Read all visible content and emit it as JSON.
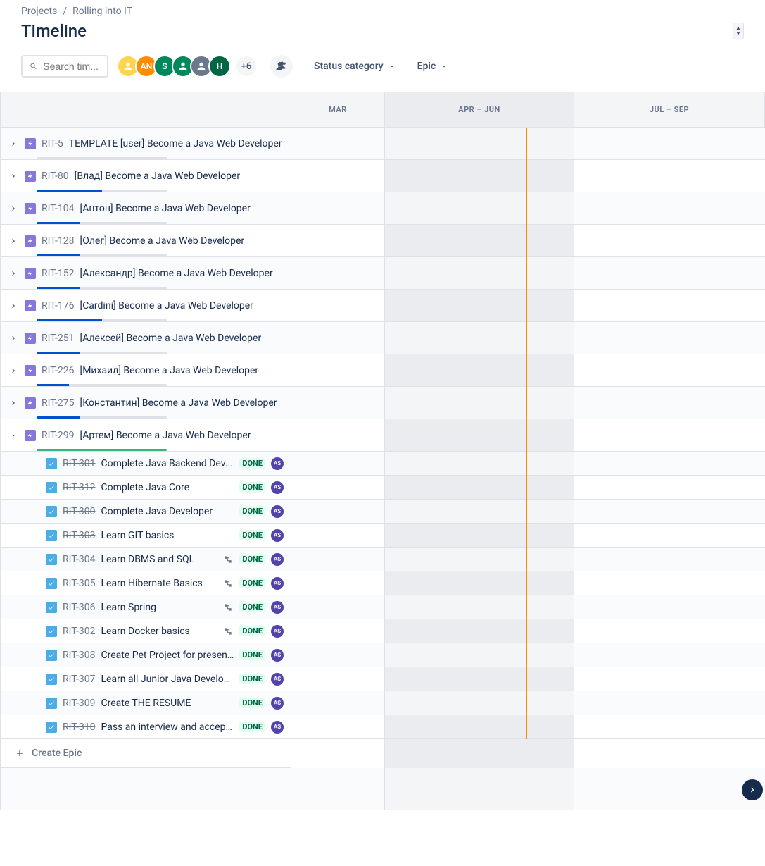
{
  "breadcrumb": {
    "projects": "Projects",
    "project_name": "Rolling into IT"
  },
  "page_title": "Timeline",
  "search": {
    "placeholder": "Search tim..."
  },
  "avatars": [
    {
      "label": "",
      "color": "yellow"
    },
    {
      "label": "AN",
      "color": "orange"
    },
    {
      "label": "S",
      "color": "green"
    },
    {
      "label": "",
      "color": "teal"
    },
    {
      "label": "",
      "color": "grey"
    },
    {
      "label": "H",
      "color": "darkgreen"
    }
  ],
  "avatars_more": "+6",
  "filters": {
    "status": "Status category",
    "epic": "Epic"
  },
  "columns": {
    "mar": "MAR",
    "apr_jun": "APR – JUN",
    "jul_sep": "JUL – SEP"
  },
  "epics": [
    {
      "key": "RIT-5",
      "summary": "TEMPLATE [user] Become a Java Web Developer",
      "expanded": false,
      "progress_blue": 0,
      "progress_green": 0
    },
    {
      "key": "RIT-80",
      "summary": "[Влад] Become a Java Web Developer",
      "expanded": false,
      "progress_blue": 50,
      "progress_green": 0
    },
    {
      "key": "RIT-104",
      "summary": "[Антон] Become a Java Web Developer",
      "expanded": false,
      "progress_blue": 33,
      "progress_green": 0
    },
    {
      "key": "RIT-128",
      "summary": "[Олег] Become a Java Web Developer",
      "expanded": false,
      "progress_blue": 33,
      "progress_green": 0
    },
    {
      "key": "RIT-152",
      "summary": "[Александр] Become a Java Web Developer",
      "expanded": false,
      "progress_blue": 33,
      "progress_green": 0
    },
    {
      "key": "RIT-176",
      "summary": "[Cardini] Become a Java Web Developer",
      "expanded": false,
      "progress_blue": 50,
      "progress_green": 0
    },
    {
      "key": "RIT-251",
      "summary": "[Алексей] Become a Java Web Developer",
      "expanded": false,
      "progress_blue": 33,
      "progress_green": 0
    },
    {
      "key": "RIT-226",
      "summary": "[Михаил] Become a Java Web Developer",
      "expanded": false,
      "progress_blue": 25,
      "progress_green": 0
    },
    {
      "key": "RIT-275",
      "summary": "[Константин] Become a Java Web Developer",
      "expanded": false,
      "progress_blue": 33,
      "progress_green": 0
    },
    {
      "key": "RIT-299",
      "summary": "[Артем] Become a Java Web Developer",
      "expanded": true,
      "progress_blue": 0,
      "progress_green": 100
    }
  ],
  "subtasks": [
    {
      "key": "RIT-301",
      "summary": "Complete Java Backend Dev...",
      "status": "DONE",
      "assignee": "AS",
      "dep": false
    },
    {
      "key": "RIT-312",
      "summary": "Complete Java Core",
      "status": "DONE",
      "assignee": "AS",
      "dep": false
    },
    {
      "key": "RIT-300",
      "summary": "Complete Java Developer",
      "status": "DONE",
      "assignee": "AS",
      "dep": false
    },
    {
      "key": "RIT-303",
      "summary": "Learn GIT basics",
      "status": "DONE",
      "assignee": "AS",
      "dep": false
    },
    {
      "key": "RIT-304",
      "summary": "Learn DBMS and SQL",
      "status": "DONE",
      "assignee": "AS",
      "dep": true
    },
    {
      "key": "RIT-305",
      "summary": "Learn Hibernate Basics",
      "status": "DONE",
      "assignee": "AS",
      "dep": true
    },
    {
      "key": "RIT-306",
      "summary": "Learn Spring",
      "status": "DONE",
      "assignee": "AS",
      "dep": true
    },
    {
      "key": "RIT-302",
      "summary": "Learn Docker basics",
      "status": "DONE",
      "assignee": "AS",
      "dep": true
    },
    {
      "key": "RIT-308",
      "summary": "Create Pet Project for presen...",
      "status": "DONE",
      "assignee": "AS",
      "dep": false
    },
    {
      "key": "RIT-307",
      "summary": "Learn all Junior Java Develop...",
      "status": "DONE",
      "assignee": "AS",
      "dep": false
    },
    {
      "key": "RIT-309",
      "summary": "Create THE RESUME",
      "status": "DONE",
      "assignee": "AS",
      "dep": false
    },
    {
      "key": "RIT-310",
      "summary": "Pass an interview and accept...",
      "status": "DONE",
      "assignee": "AS",
      "dep": false
    }
  ],
  "create_epic": "Create Epic"
}
